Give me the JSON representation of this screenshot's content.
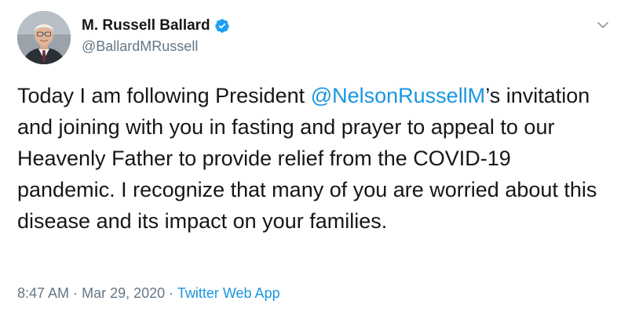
{
  "author": {
    "display_name": "M. Russell Ballard",
    "handle": "@BallardMRussell",
    "verified": true
  },
  "icons": {
    "verified": "verified-badge-icon",
    "menu": "chevron-down-icon"
  },
  "tweet": {
    "text_before": "Today I am following President ",
    "mention": "@NelsonRussellM",
    "text_after": "’s invitation and joining with you in fasting and prayer to appeal to our Heavenly Father to provide relief from the COVID-19 pandemic. I recognize that many of you are worried about this disease and its impact on your families."
  },
  "meta": {
    "time": "8:47 AM",
    "separator": "·",
    "date": "Mar 29, 2020",
    "source": "Twitter Web App"
  },
  "colors": {
    "link": "#1b95e0",
    "secondary_text": "#657786",
    "primary_text": "#14171a",
    "verified": "#1da1f2"
  }
}
